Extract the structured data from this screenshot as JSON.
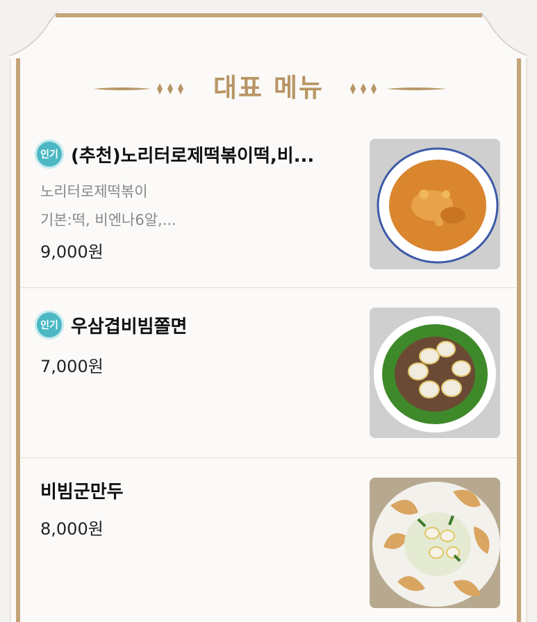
{
  "section": {
    "title": "대표 메뉴"
  },
  "menu": {
    "items": [
      {
        "badge": "인기",
        "name": "(추천)노리터로제떡볶이떡,비...",
        "desc_line1": "노리터로제떡볶이",
        "desc_line2": "기본:떡, 비엔나6알,...",
        "price": "9,000원",
        "image": "rose-tteokbokki-photo"
      },
      {
        "badge": "인기",
        "name": "우삼겹비빔쫄면",
        "price": "7,000원",
        "image": "beef-bibim-jjolmyeon-photo"
      },
      {
        "name": "비빔군만두",
        "price": "8,000원",
        "image": "bibim-fried-dumpling-photo"
      }
    ]
  },
  "colors": {
    "gold": "#b89565",
    "badge": "#4bb8c3",
    "divider": "#e6ddcf"
  }
}
